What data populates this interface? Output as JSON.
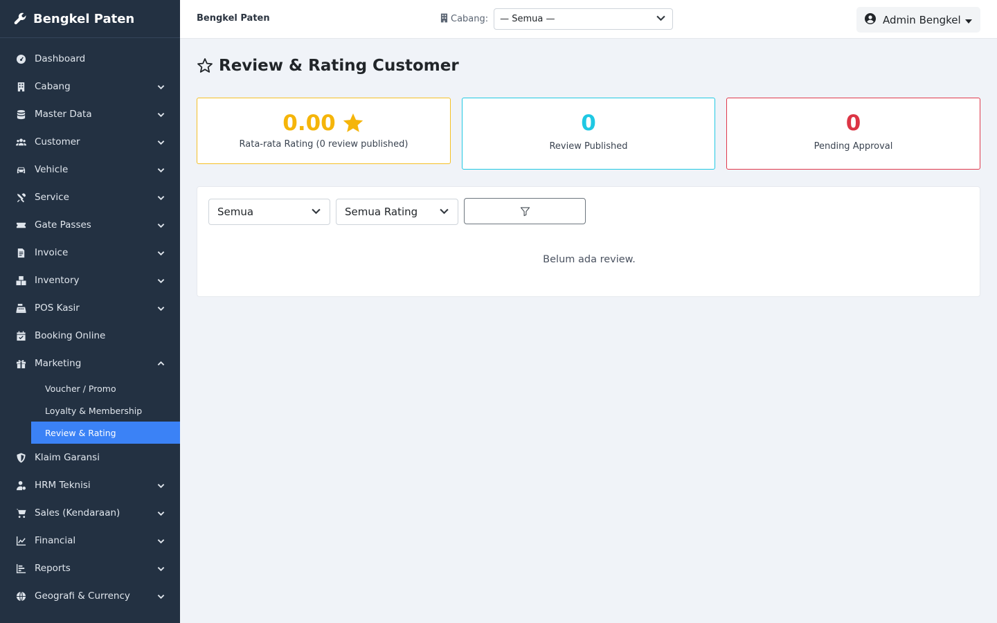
{
  "app": {
    "brand": "Bengkel Paten"
  },
  "sidebar": {
    "items": [
      {
        "label": "Dashboard",
        "icon": "dashboard-icon",
        "expandable": false
      },
      {
        "label": "Cabang",
        "icon": "building-icon",
        "expandable": true
      },
      {
        "label": "Master Data",
        "icon": "database-icon",
        "expandable": true
      },
      {
        "label": "Customer",
        "icon": "users-icon",
        "expandable": true
      },
      {
        "label": "Vehicle",
        "icon": "car-icon",
        "expandable": true
      },
      {
        "label": "Service",
        "icon": "tools-icon",
        "expandable": true
      },
      {
        "label": "Gate Passes",
        "icon": "ticket-icon",
        "expandable": true
      },
      {
        "label": "Invoice",
        "icon": "invoice-icon",
        "expandable": true
      },
      {
        "label": "Inventory",
        "icon": "boxes-icon",
        "expandable": true
      },
      {
        "label": "POS Kasir",
        "icon": "cash-register-icon",
        "expandable": true
      },
      {
        "label": "Booking Online",
        "icon": "calendar-icon",
        "expandable": false
      },
      {
        "label": "Marketing",
        "icon": "gift-icon",
        "expandable": true,
        "expanded": true
      },
      {
        "label": "Klaim Garansi",
        "icon": "shield-icon",
        "expandable": false
      },
      {
        "label": "HRM Teknisi",
        "icon": "user-gear-icon",
        "expandable": true
      },
      {
        "label": "Sales (Kendaraan)",
        "icon": "cart-icon",
        "expandable": true
      },
      {
        "label": "Financial",
        "icon": "chart-line-icon",
        "expandable": true
      },
      {
        "label": "Reports",
        "icon": "reports-icon",
        "expandable": true
      },
      {
        "label": "Geografi & Currency",
        "icon": "globe-icon",
        "expandable": true
      }
    ],
    "marketing_sub": [
      {
        "label": "Voucher / Promo",
        "active": false
      },
      {
        "label": "Loyalty & Membership",
        "active": false
      },
      {
        "label": "Review & Rating",
        "active": true
      }
    ]
  },
  "topbar": {
    "title": "Bengkel Paten",
    "cabang_label": "Cabang:",
    "cabang_value": "— Semua —",
    "user_name": "Admin Bengkel"
  },
  "page": {
    "title": "Review & Rating Customer"
  },
  "stats": {
    "avg_rating": "0.00",
    "avg_label": "Rata-rata Rating (0 review published)",
    "published_count": "0",
    "published_label": "Review Published",
    "pending_count": "0",
    "pending_label": "Pending Approval"
  },
  "filters": {
    "status_value": "Semua",
    "rating_value": "Semua Rating"
  },
  "empty_text": "Belum ada review.",
  "colors": {
    "sidebar_bg": "#233142",
    "active": "#3b82f6",
    "warning": "#f5b50a",
    "info": "#1fc8e3",
    "danger": "#dc3545"
  }
}
